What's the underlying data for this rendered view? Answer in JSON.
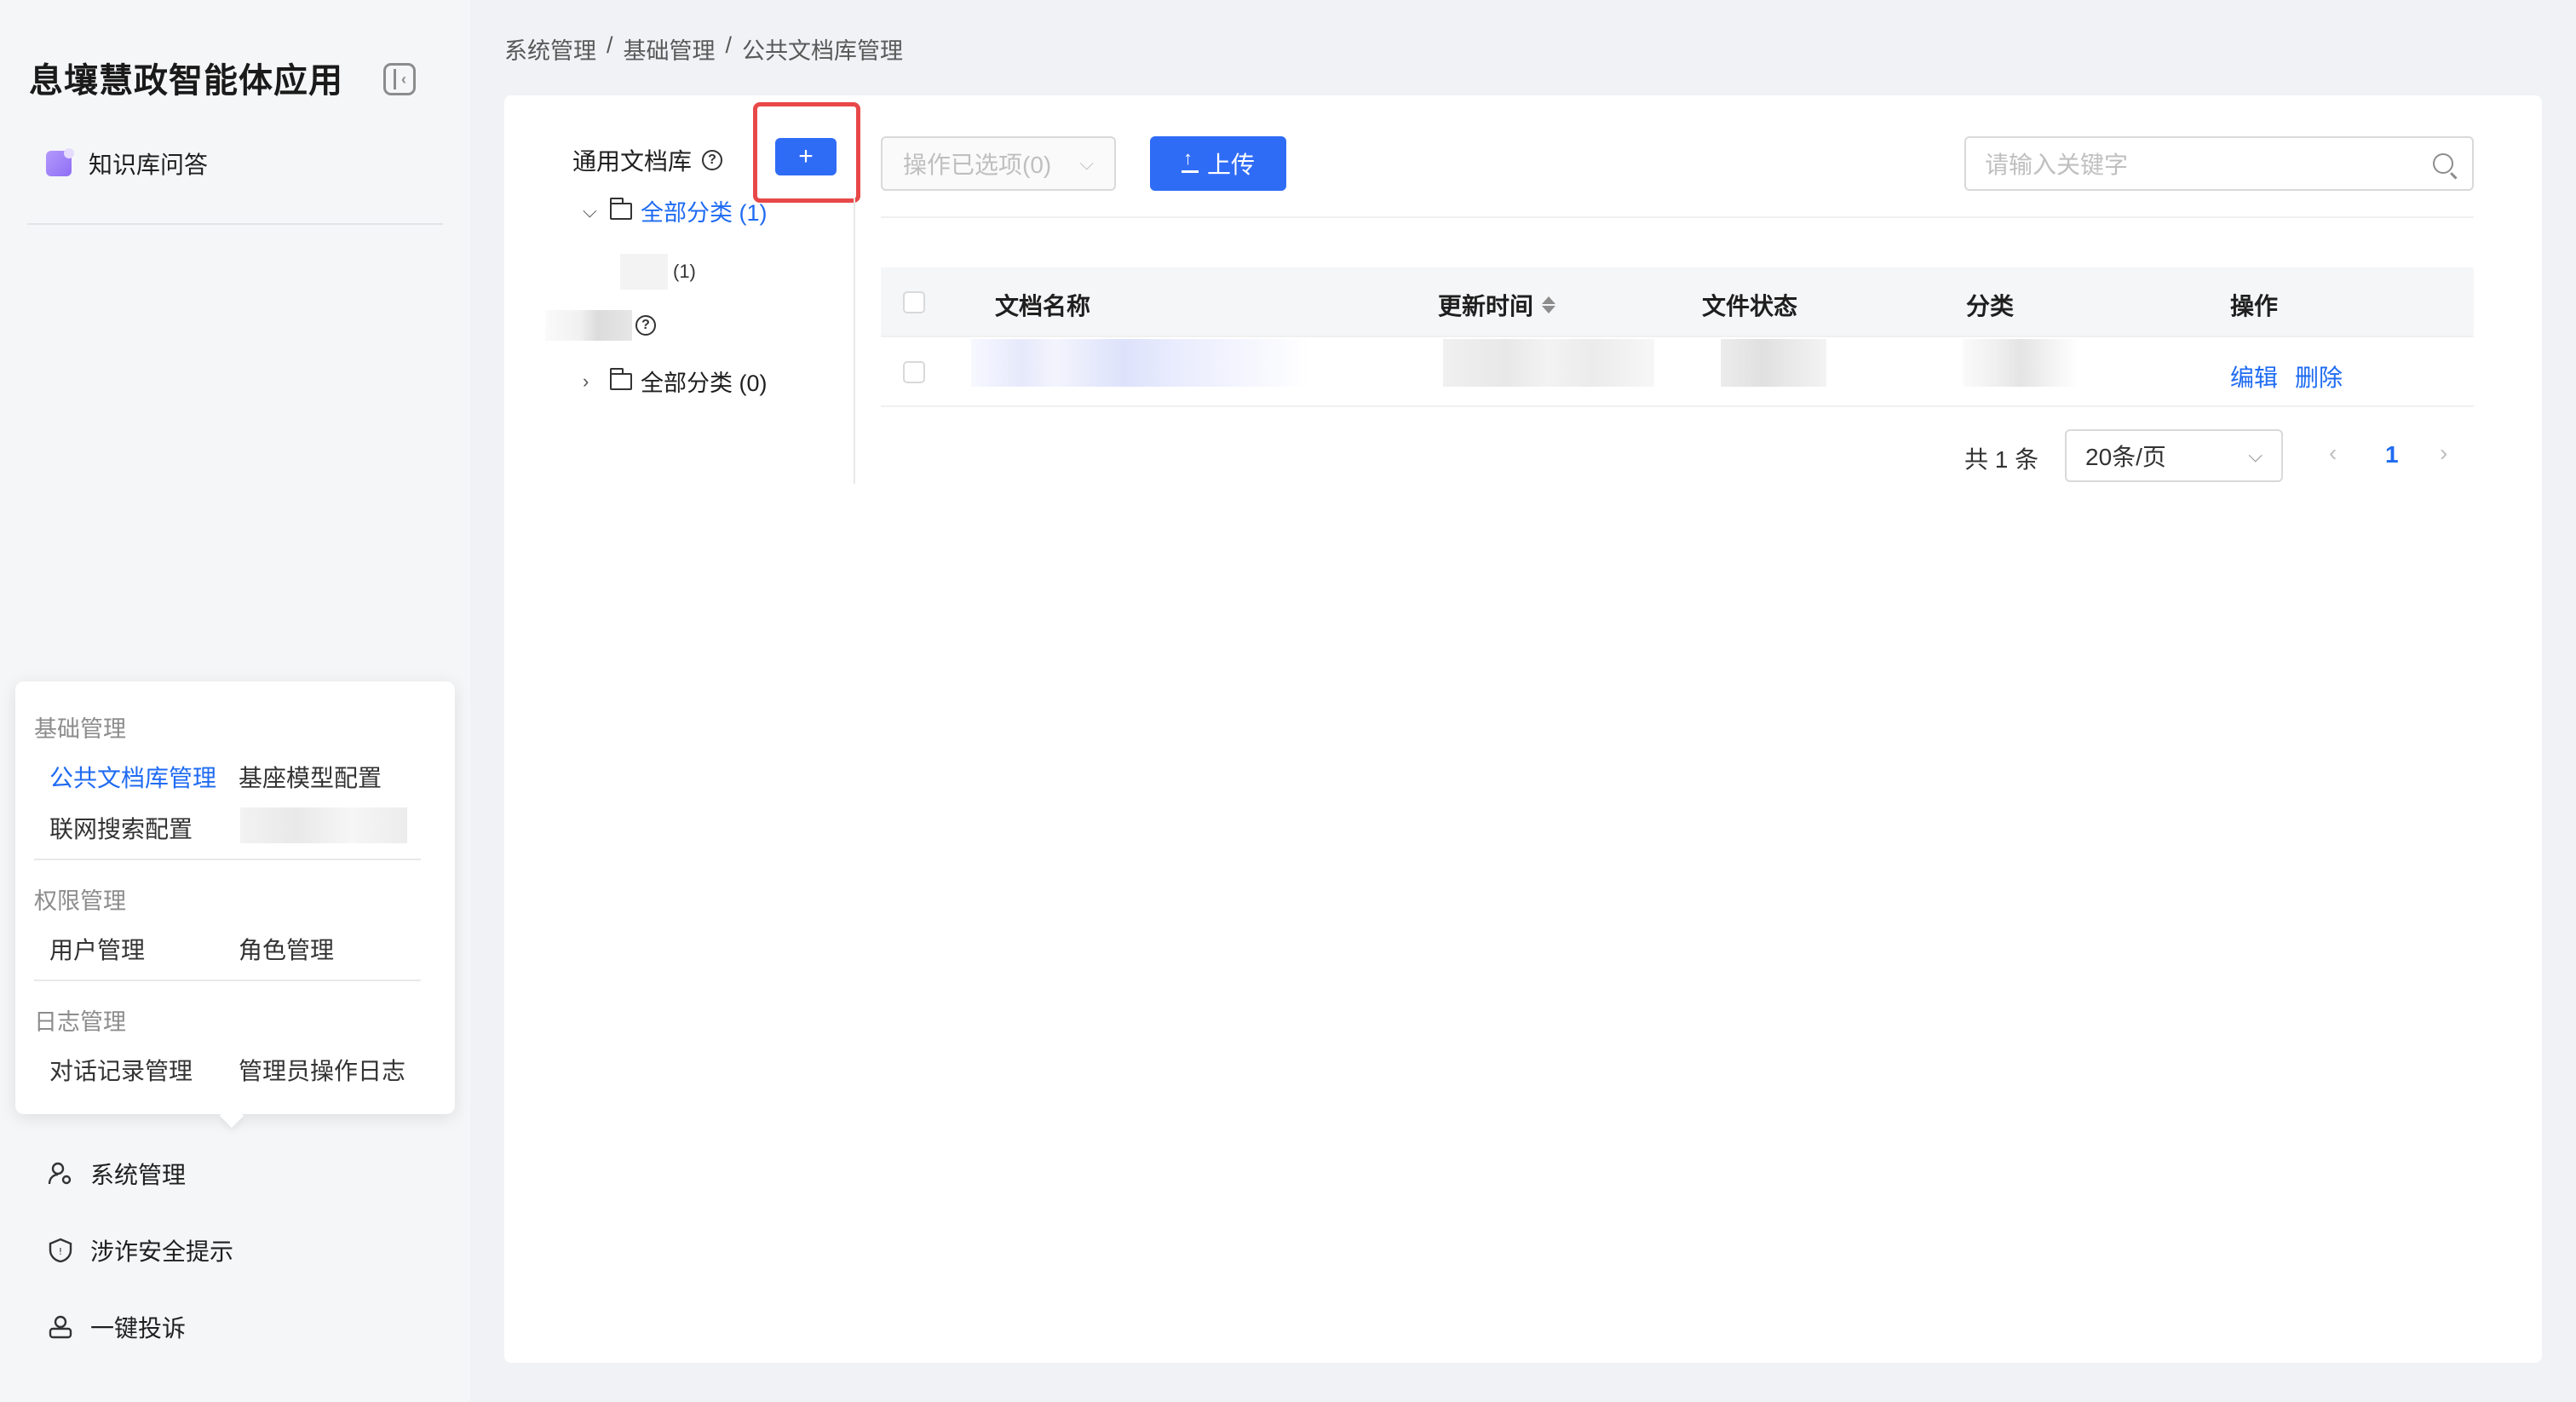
{
  "app": {
    "title": "息壤慧政智能体应用",
    "collapse_icon": "collapse-sidebar-icon"
  },
  "sidebar": {
    "top_items": [
      {
        "label": "知识库问答",
        "icon": "knowledge-base-icon"
      }
    ],
    "popover": {
      "groups": [
        {
          "title": "基础管理",
          "items": [
            "公共文档库管理",
            "基座模型配置",
            "联网搜索配置"
          ]
        },
        {
          "title": "权限管理",
          "items": [
            "用户管理",
            "角色管理"
          ]
        },
        {
          "title": "日志管理",
          "items": [
            "对话记录管理",
            "管理员操作日志"
          ]
        }
      ],
      "active_item": "公共文档库管理"
    },
    "bottom_items": [
      {
        "label": "系统管理",
        "icon": "system-settings-icon"
      },
      {
        "label": "涉诈安全提示",
        "icon": "shield-icon"
      },
      {
        "label": "一键投诉",
        "icon": "complaint-icon"
      }
    ]
  },
  "breadcrumb": [
    "系统管理",
    "基础管理",
    "公共文档库管理"
  ],
  "breadcrumb_separator": "/",
  "tree": {
    "title": "通用文档库",
    "add_button": "+",
    "nodes": [
      {
        "label": "全部分类 (1)",
        "expanded": true,
        "selected": true
      },
      {
        "label": "(1)",
        "child": true
      },
      {
        "label": "全部分类 (0)",
        "expanded": false,
        "selected": false
      }
    ]
  },
  "toolbar": {
    "ops_select_placeholder": "操作已选项(0)",
    "upload_label": "上传",
    "search_placeholder": "请输入关键字"
  },
  "table": {
    "columns": [
      "文档名称",
      "更新时间",
      "文件状态",
      "分类",
      "操作"
    ],
    "rows": [
      {
        "actions": [
          "编辑",
          "删除"
        ]
      }
    ]
  },
  "pagination": {
    "total": "共 1 条",
    "page_size": "20条/页",
    "current_page": "1",
    "prev": "‹",
    "next": "›"
  },
  "colors": {
    "primary": "#2f6cf6",
    "highlight": "#e84848",
    "link": "#1f6bf2"
  }
}
